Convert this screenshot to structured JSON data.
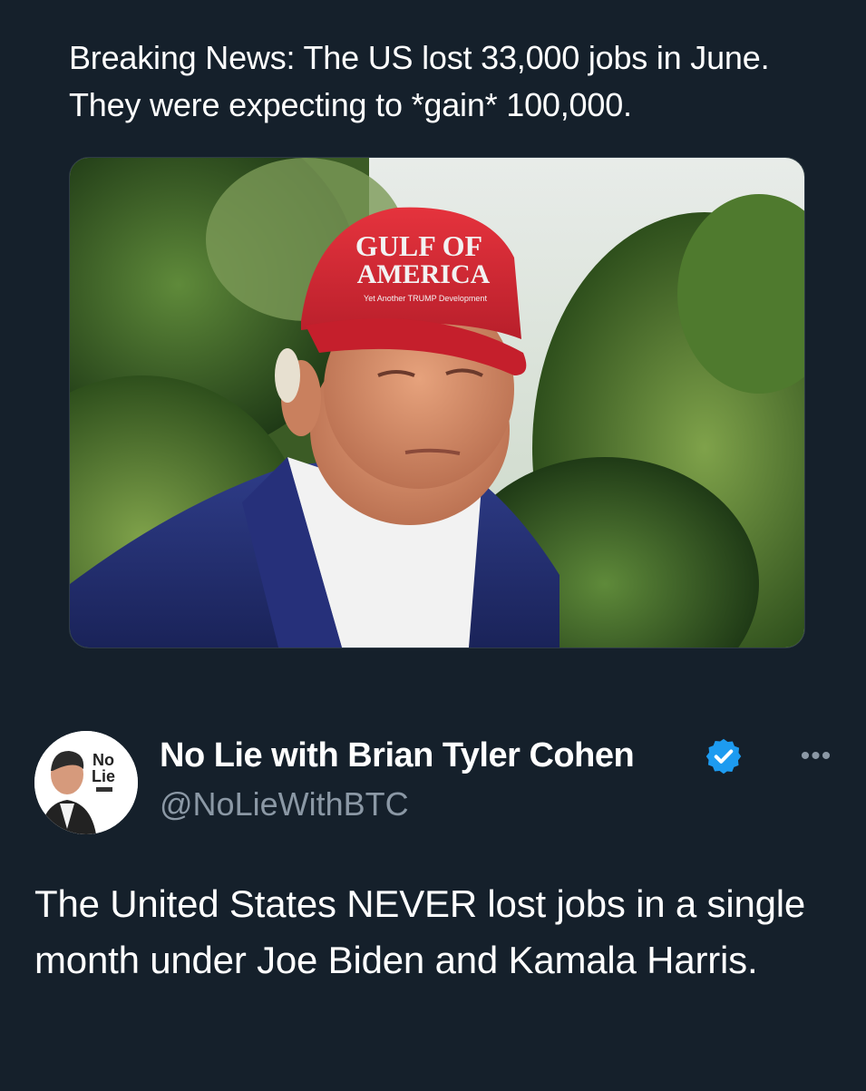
{
  "quoted_post": {
    "text": "Breaking News: The US lost 33,000 jobs in June. They were expecting to *gain* 100,000.",
    "image": {
      "hat_text_line1": "GULF OF",
      "hat_text_line2": "AMERICA",
      "hat_small_text": "Yet Another TRUMP Development"
    }
  },
  "post": {
    "author": {
      "display_name": "No Lie with Brian Tyler Cohen",
      "handle": "@NoLieWithBTC",
      "verified": true,
      "avatar_logo_line1": "No",
      "avatar_logo_line2": "Lie"
    },
    "more_label": "•••",
    "text": "The United States NEVER lost jobs in a single month under Joe Biden and Kamala Harris."
  },
  "colors": {
    "background": "#15202b",
    "text": "#ffffff",
    "secondary_text": "#8b98a5",
    "verified_badge": "#1d9bf0"
  }
}
